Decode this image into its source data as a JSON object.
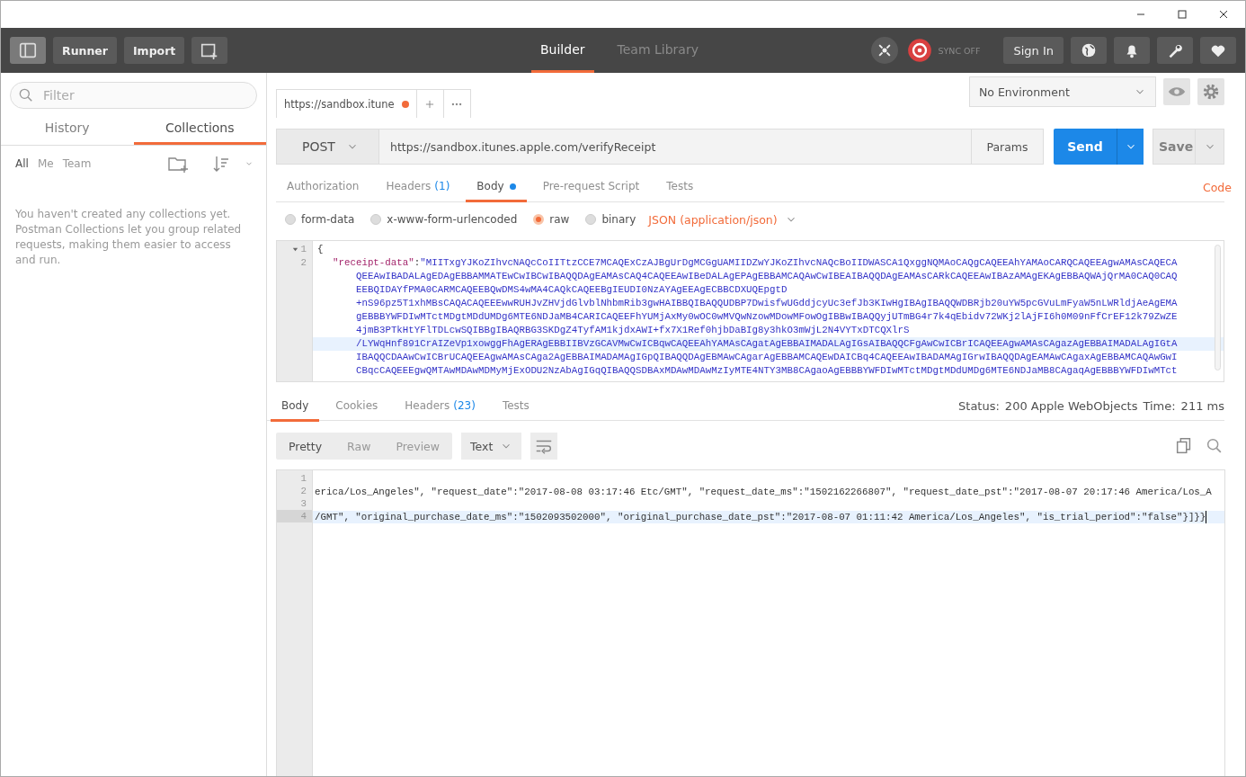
{
  "header": {
    "buttons": [
      "Runner",
      "Import"
    ],
    "tabs": [
      {
        "label": "Builder",
        "selected": true
      },
      {
        "label": "Team Library",
        "selected": false
      }
    ],
    "sync": "SYNC OFF",
    "sign_in": "Sign In"
  },
  "sidebar": {
    "filter": {
      "placeholder": "Filter"
    },
    "tabs": [
      {
        "label": "History",
        "selected": false
      },
      {
        "label": "Collections",
        "selected": true
      }
    ],
    "scopes": [
      {
        "label": "All",
        "selected": true
      },
      {
        "label": "Me",
        "selected": false
      },
      {
        "label": "Team",
        "selected": false
      }
    ],
    "empty_message": "You haven't created any collections yet. Postman Collections let you group related requests, making them easier to access and run."
  },
  "request_tabs": [
    {
      "label": "https://sandbox.itune",
      "unsaved": true,
      "selected": true
    }
  ],
  "environment": {
    "value": "No Environment"
  },
  "request": {
    "method": "POST",
    "url": "https://sandbox.itunes.apple.com/verifyReceipt",
    "params": "Params",
    "send": "Send",
    "save": "Save"
  },
  "request_sections": [
    {
      "label": "Authorization",
      "selected": false
    },
    {
      "label": "Headers",
      "count": "(1)",
      "selected": false
    },
    {
      "label": "Body",
      "dot": true,
      "selected": true
    },
    {
      "label": "Pre-request Script",
      "selected": false
    },
    {
      "label": "Tests",
      "selected": false
    }
  ],
  "code_link": "Code",
  "body_modes": [
    {
      "label": "form-data",
      "selected": false
    },
    {
      "label": "x-www-form-urlencoded",
      "selected": false
    },
    {
      "label": "raw",
      "selected": true
    },
    {
      "label": "binary",
      "selected": false
    }
  ],
  "content_type": "JSON (application/json)",
  "request_body": {
    "lines": [
      {
        "number": "1",
        "foldable": true,
        "text": "{"
      },
      {
        "number": "2",
        "key": "\"receipt-data\"",
        "separator": ":",
        "segments": [
          {
            "text": "\"MIITxgYJKoZIhvcNAQcCoIITtzCCE7MCAQExCzAJBgUrDgMCGgUAMIIDZwYJKoZIhvcNAQcBoIIDWASCA1QxggNQMAoCAQgCAQEEAhYAMAoCARQCAQEEAgwAMAsCAQECA",
            "current": false
          },
          {
            "text": "QEEAwIBADALAgEDAgEBBAMMATEwCwIBCwIBAQQDAgEAMAsCAQ4CAQEEAwIBeDALAgEPAgEBBAMCAQAwCwIBEAIBAQQDAgEAMAsCARkCAQEEAwIBAzAMAgEKAgEBBAQWAjQrMA0CAQ0CAQ",
            "current": false
          },
          {
            "text": "EEBQIDAYfPMA0CARMCAQEEBQwDMS4wMA4CAQkCAQEEBgIEUDI0NzAYAgEEAgECBBCDXUQEpgtD",
            "current": false
          },
          {
            "text": "+nS96pz5T1xhMBsCAQACAQEEEwwRUHJvZHVjdGlvblNhbmRib3gwHAIBBQIBAQQUDBP7DwisfwUGddjcyUc3efJb3KIwHgIBAgIBAQQWDBRjb20uYW5pcGVuLmFyaW5nLWRldjAeAgEMA",
            "current": false
          },
          {
            "text": "gEBBBYWFDIwMTctMDgtMDdUMDg6MTE6NDJaMB4CARICAQEEFhYUMjAxMy0wOC0wMVQwNzowMDowMFowOgIBBwIBAQQyjUTmBG4r7k4qEbidv72WKj2lAjFI6h0M09nFfCrEF12k79ZwZE",
            "current": false
          },
          {
            "text": "4jmB3PTkHtYFlTDLcwSQIBBgIBAQRBG3SKDgZ4TyfAM1kjdxAWI+fx7X1Ref0hjbDaBIg8y3hkO3mWjL2N4VYTxDTCQXlrS",
            "current": false
          },
          {
            "text": "/LYWqHnf891CrAIZeVp1xowggFhAgERAgEBBIIBVzGCAVMwCwICBqwCAQEEAhYAMAsCAgatAgEBBAIMADALAgIGsAIBAQQCFgAwCwICBrICAQEEAgwAMAsCAgazAgEBBAIMADALAgIGtA",
            "current": true
          },
          {
            "text": "IBAQQCDAAwCwICBrUCAQEEAgwAMAsCAga2AgEBBAIMADAMAgIGpQIBAQQDAgEBMAwCAgarAgEBBAMCAQEwDAICBq4CAQEEAwIBADAMAgIGrwIBAQQDAgEAMAwCAgaxAgEBBAMCAQAwGwI",
            "current": false
          },
          {
            "text": "CBqcCAQEEEgwQMTAwMDAwMDMyMjExODU2NzAbAgIGqQIBAQQSDBAxMDAwMDAwMzIyMTE4NTY3MB8CAgaoAgEBBBYWFDIwMTctMDgtMDdUMDg6MTE6NDJaMB8CAgaqAgEBBBYWFDIwMTct",
            "current": false
          }
        ]
      }
    ]
  },
  "response_tabs": [
    {
      "label": "Body",
      "selected": true
    },
    {
      "label": "Cookies",
      "selected": false
    },
    {
      "label": "Headers",
      "count": "(23)",
      "selected": false
    },
    {
      "label": "Tests",
      "selected": false
    }
  ],
  "status": {
    "label": "Status:",
    "value": "200 Apple WebObjects"
  },
  "time": {
    "label": "Time:",
    "value": "211 ms"
  },
  "views": [
    {
      "label": "Pretty",
      "selected": true
    },
    {
      "label": "Raw",
      "selected": false
    },
    {
      "label": "Preview",
      "selected": false
    }
  ],
  "format": "Text",
  "response_body": {
    "lines": [
      {
        "number": "1",
        "current": false
      },
      {
        "number": "2",
        "text": "erica/Los_Angeles\", \"request_date\":\"2017-08-08 03:17:46 Etc/GMT\", \"request_date_ms\":\"1502162266807\", \"request_date_pst\":\"2017-08-07 20:17:46 America/Los_A",
        "current": false
      },
      {
        "number": "3",
        "current": false
      },
      {
        "number": "4",
        "text": "/GMT\", \"original_purchase_date_ms\":\"1502093502000\", \"original_purchase_date_pst\":\"2017-08-07 01:11:42 America/Los_Angeles\", \"is_trial_period\":\"false\"}]}}",
        "current": true
      }
    ]
  }
}
